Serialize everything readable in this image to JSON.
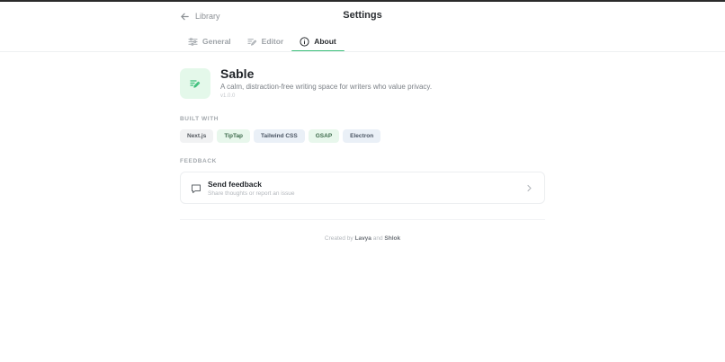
{
  "header": {
    "back_label": "Library",
    "title": "Settings"
  },
  "tabs": [
    {
      "label": "General",
      "icon": "sliders-icon",
      "active": false
    },
    {
      "label": "Editor",
      "icon": "pen-lines-icon",
      "active": false
    },
    {
      "label": "About",
      "icon": "info-circle-icon",
      "active": true
    }
  ],
  "app": {
    "name": "Sable",
    "description": "A calm, distraction-free writing space for writers who value privacy.",
    "version": "v1.0.0",
    "icon": "pen-lines-icon"
  },
  "built_with": {
    "label": "BUILT WITH",
    "chips": [
      "Next.js",
      "TipTap",
      "Tailwind CSS",
      "GSAP",
      "Electron"
    ]
  },
  "feedback": {
    "label": "FEEDBACK",
    "title": "Send feedback",
    "subtitle": "Share thoughts or report an issue"
  },
  "credits": {
    "prefix": "Created by",
    "author1": "Lavya",
    "joiner": "and",
    "author2": "Shlok"
  },
  "colors": {
    "accent": "#3bbf7a",
    "tile_bg": "#e4f8ea"
  }
}
